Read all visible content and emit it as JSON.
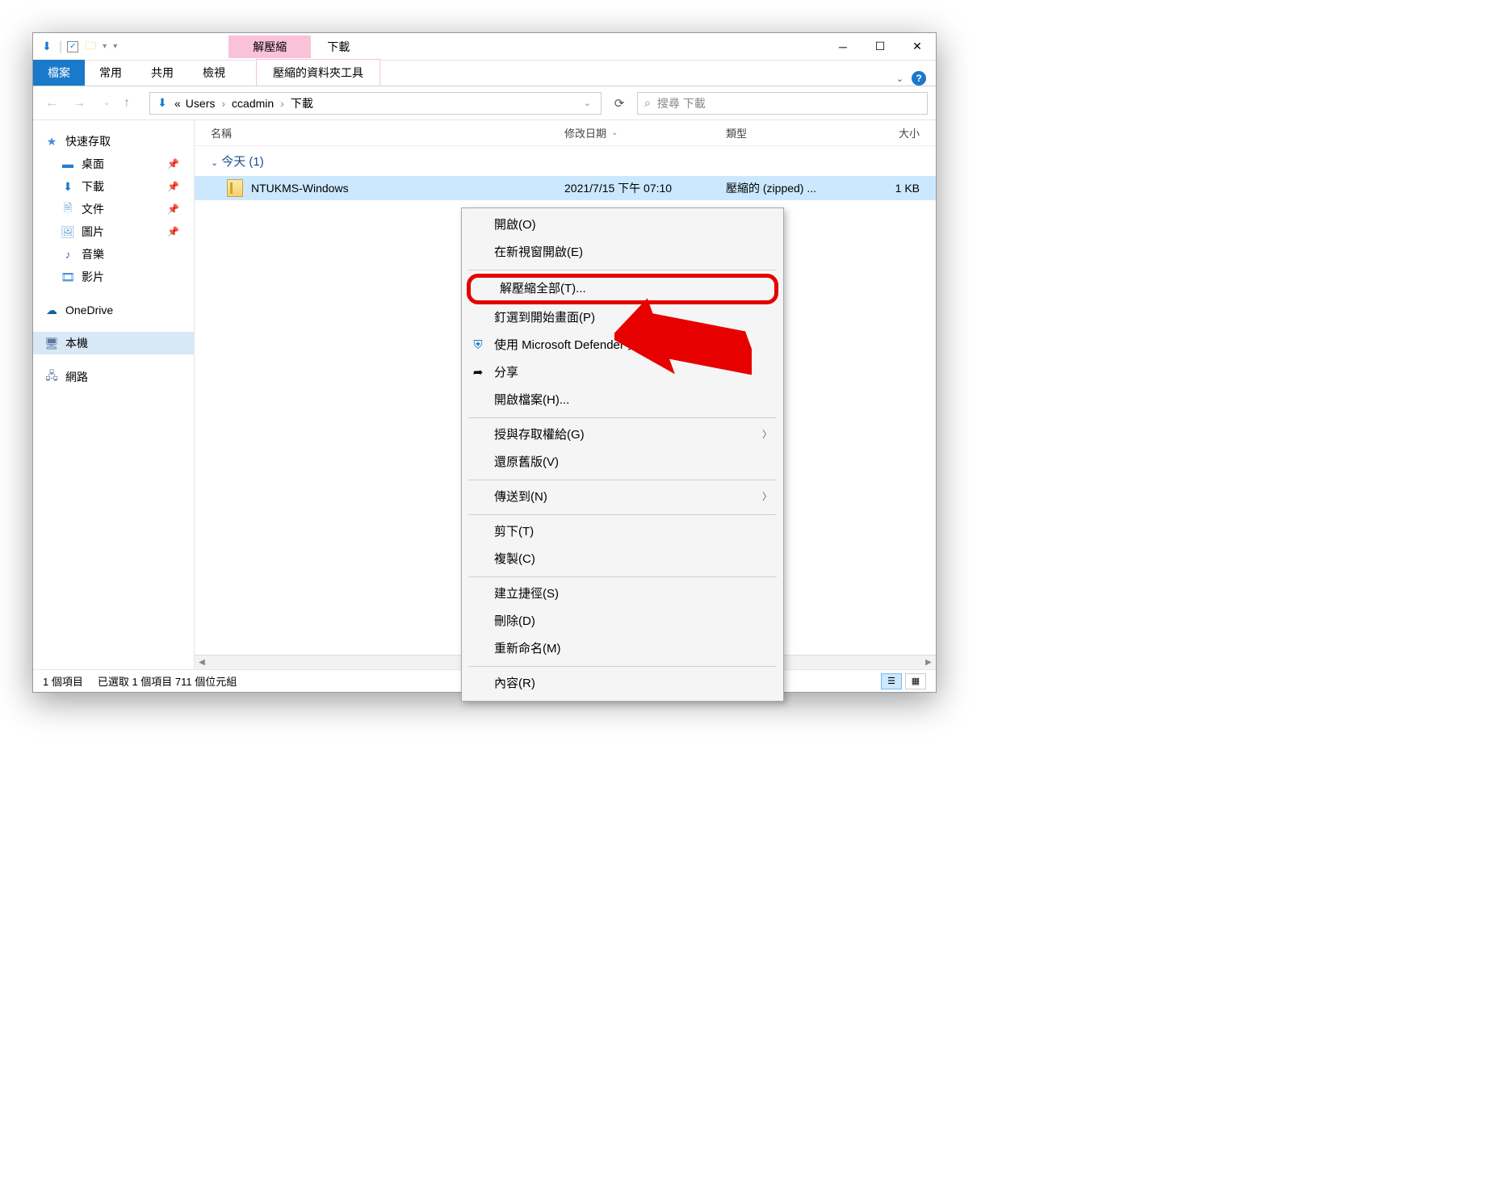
{
  "titlebar": {
    "context_tab": "解壓縮",
    "title": "下載"
  },
  "ribbon": {
    "file": "檔案",
    "home": "常用",
    "share": "共用",
    "view": "檢視",
    "context_tools": "壓縮的資料夾工具"
  },
  "nav": {
    "crumbs": [
      "Users",
      "ccadmin",
      "下載"
    ],
    "crumb_prefix": "«"
  },
  "search": {
    "placeholder": "搜尋 下載"
  },
  "sidebar": {
    "quick_access": "快速存取",
    "desktop": "桌面",
    "downloads": "下載",
    "documents": "文件",
    "pictures": "圖片",
    "music": "音樂",
    "videos": "影片",
    "onedrive": "OneDrive",
    "thispc": "本機",
    "network": "網路"
  },
  "columns": {
    "name": "名稱",
    "date": "修改日期",
    "type": "類型",
    "size": "大小"
  },
  "group": {
    "today": "今天 (1)"
  },
  "file": {
    "name": "NTUKMS-Windows",
    "date": "2021/7/15 下午 07:10",
    "type": "壓縮的 (zipped) ...",
    "size": "1 KB"
  },
  "context_menu": {
    "open": "開啟(O)",
    "open_new_window": "在新視窗開啟(E)",
    "extract_all": "解壓縮全部(T)...",
    "pin_start": "釘選到開始畫面(P)",
    "defender": "使用 Microsoft Defender 掃描...",
    "share": "分享",
    "open_with": "開啟檔案(H)...",
    "grant_access": "授與存取權給(G)",
    "restore_previous": "還原舊版(V)",
    "send_to": "傳送到(N)",
    "cut": "剪下(T)",
    "copy": "複製(C)",
    "create_shortcut": "建立捷徑(S)",
    "delete": "刪除(D)",
    "rename": "重新命名(M)",
    "properties": "內容(R)"
  },
  "status": {
    "items": "1 個項目",
    "selected": "已選取 1 個項目  711 個位元組"
  }
}
